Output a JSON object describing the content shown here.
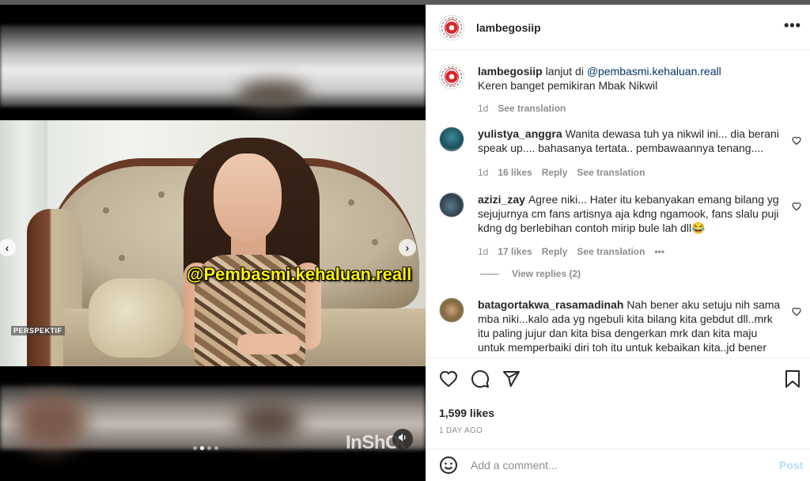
{
  "post": {
    "author": "lambegosiip",
    "more_label": "•••",
    "likes": "1,599 likes",
    "time_ago": "1 DAY AGO",
    "carousel_dots": 4,
    "active_dot": 1
  },
  "media": {
    "caption_overlay": "@Pembasmi.kehaluan.reall",
    "channel_tag": "PERSPEKTIF",
    "watermark": "InShOt",
    "prev_label": "‹",
    "next_label": "›",
    "mute_icon": "speaker-icon"
  },
  "caption": {
    "username": "lambegosiip",
    "text_before": "lanjut di ",
    "mention": "@pembasmi.kehaluan.reall",
    "line2": "Keren banget pemikiran Mbak Nikwil",
    "age": "1d",
    "see_translation": "See translation"
  },
  "comments": [
    {
      "username": "yulistya_anggra",
      "text": "Wanita dewasa tuh ya nikwil ini... dia berani speak up.... bahasanya tertata.. pembawaannya tenang....",
      "age": "1d",
      "likes": "16 likes",
      "reply": "Reply",
      "see_translation": "See translation"
    },
    {
      "username": "azizi_zay",
      "text": "Agree niki... Hater itu kebanyakan emang bilang yg sejujurnya cm fans artisnya aja kdng ngamook, fans slalu puji kdng dg berlebihan contoh mirip bule lah dll😂",
      "age": "1d",
      "likes": "17 likes",
      "reply": "Reply",
      "see_translation": "See translation",
      "more": "•••",
      "view_replies": "View replies (2)"
    },
    {
      "username": "batagortakwa_rasamadinah",
      "text": "Nah bener aku setuju nih sama mba niki...kalo ada yg ngebuli kita bilang kita gebdut dll..mrk itu paling jujur dan kita bisa dengerkan mrk dan kita maju untuk memperbaiki diri toh itu untuk kebaikan kita..jd bener"
    }
  ],
  "add_comment": {
    "placeholder": "Add a comment...",
    "post_label": "Post"
  },
  "colors": {
    "link": "#00376b",
    "meta": "#8e8e8e",
    "post_disabled": "#b2dffc",
    "caption_yellow": "#fff200"
  }
}
